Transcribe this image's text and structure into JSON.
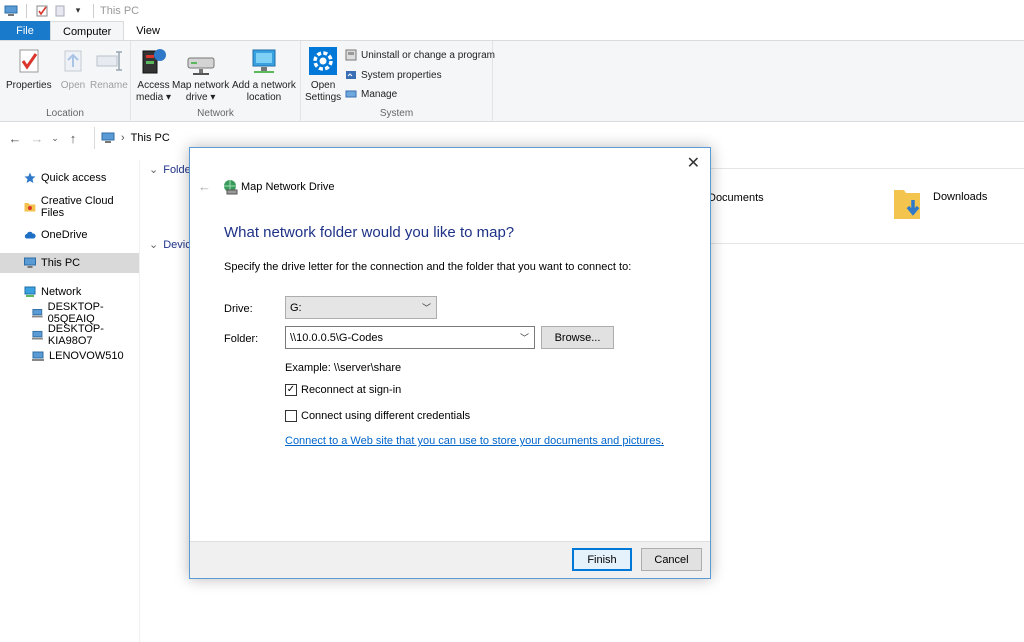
{
  "window": {
    "title": "This PC"
  },
  "tabs": [
    {
      "label": "File"
    },
    {
      "label": "Computer"
    },
    {
      "label": "View"
    }
  ],
  "ribbon": {
    "location": {
      "label": "Location",
      "buttons": [
        {
          "label": "Properties"
        },
        {
          "label": "Open"
        },
        {
          "label": "Rename"
        }
      ]
    },
    "network": {
      "label": "Network",
      "access_media": {
        "line1": "Access",
        "line2": "media"
      },
      "map_drive": {
        "line1": "Map network",
        "line2": "drive"
      },
      "add_location": {
        "line1": "Add a network",
        "line2": "location"
      }
    },
    "system": {
      "label": "System",
      "open_settings": {
        "line1": "Open",
        "line2": "Settings"
      },
      "items": [
        {
          "label": "Uninstall or change a program"
        },
        {
          "label": "System properties"
        },
        {
          "label": "Manage"
        }
      ]
    }
  },
  "address": {
    "path": "This PC"
  },
  "sidebar": {
    "items": [
      {
        "label": "Quick access"
      },
      {
        "label": "Creative Cloud Files"
      },
      {
        "label": "OneDrive"
      },
      {
        "label": "This PC"
      },
      {
        "label": "Network"
      },
      {
        "label": "DESKTOP-05QEAIQ"
      },
      {
        "label": "DESKTOP-KIA98O7"
      },
      {
        "label": "LENOVOW510"
      }
    ]
  },
  "main": {
    "folders_heading": "Folde",
    "devices_heading": "Device",
    "tiles": [
      {
        "label": "Documents"
      },
      {
        "label": "Downloads"
      }
    ]
  },
  "dialog": {
    "title": "Map Network Drive",
    "heading": "What network folder would you like to map?",
    "description": "Specify the drive letter for the connection and the folder that you want to connect to:",
    "drive_label": "Drive:",
    "drive_value": "G:",
    "folder_label": "Folder:",
    "folder_value": "\\\\10.0.0.5\\G-Codes",
    "browse_label": "Browse...",
    "example": "Example: \\\\server\\share",
    "reconnect_label": "Reconnect at sign-in",
    "reconnect_checked": true,
    "credentials_label": "Connect using different credentials",
    "credentials_checked": false,
    "link_text": "Connect to a Web site that you can use to store your documents and pictures",
    "link_suffix": ".",
    "finish_label": "Finish",
    "cancel_label": "Cancel"
  },
  "colors": {
    "accent": "#1979ca",
    "heading": "#1e3287",
    "link": "#0066cc",
    "selected": "#d9d9d9"
  }
}
